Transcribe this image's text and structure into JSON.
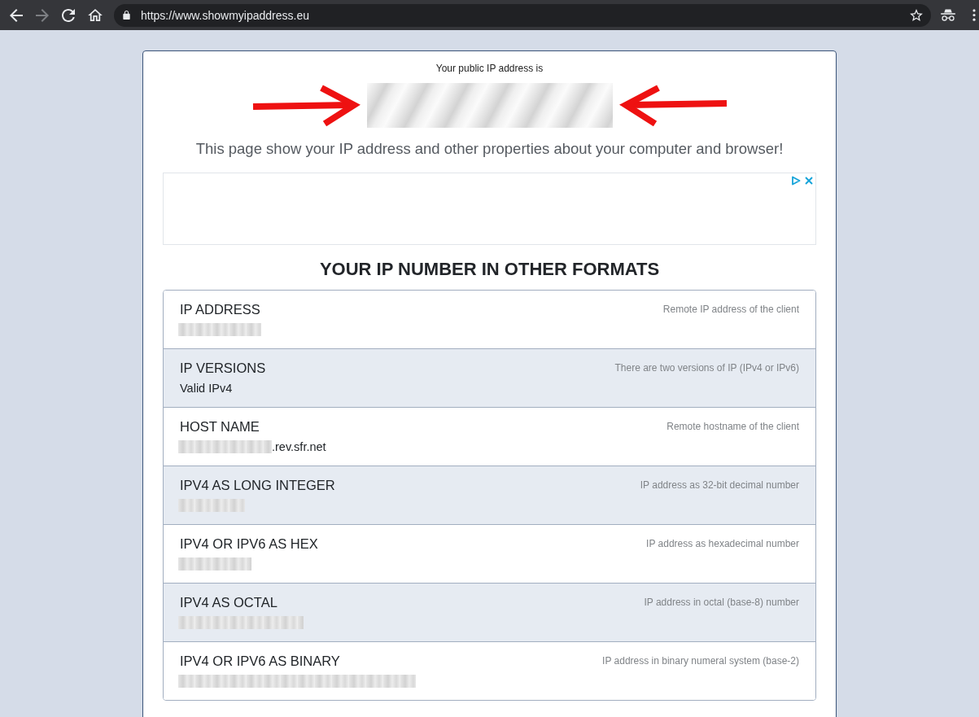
{
  "browser": {
    "nav_buttons": [
      {
        "kind": "back",
        "disabled": false
      },
      {
        "kind": "forward",
        "disabled": true
      },
      {
        "kind": "reload",
        "disabled": false
      },
      {
        "kind": "home",
        "disabled": false
      }
    ],
    "secure": true,
    "url": "https://www.showmyipaddress.eu",
    "bookmarked": false,
    "incognito": true
  },
  "public_ip": {
    "label": "Your public IP address is",
    "redacted": true,
    "arrows": true
  },
  "intro": "This page show your IP address and other properties about your computer and browser!",
  "ad_banner": {
    "adchoices": true,
    "closable": true
  },
  "formats": {
    "heading": "YOUR IP NUMBER IN OTHER FORMATS",
    "rows": [
      {
        "title": "IP ADDRESS",
        "description": "Remote IP address of the client",
        "redacted": true
      },
      {
        "title": "IP VERSIONS",
        "description": "There are two versions of IP (IPv4 or IPv6)",
        "redacted": false,
        "value": "Valid IPv4"
      },
      {
        "title": "HOST NAME",
        "description": "Remote hostname of the client",
        "redacted": true,
        "value": ".rev.sfr.net"
      },
      {
        "title": "IPV4 AS LONG INTEGER",
        "description": "IP address as 32-bit decimal number",
        "redacted": true
      },
      {
        "title": "IPV4 OR IPV6 AS HEX",
        "description": "IP address as hexadecimal number",
        "redacted": true
      },
      {
        "title": "IPV4 AS OCTAL",
        "description": "IP address in octal (base-8) number",
        "redacted": true
      },
      {
        "title": "IPV4 OR IPV6 AS BINARY",
        "description": "IP address in binary numeral system (base-2)",
        "redacted": true
      }
    ]
  }
}
